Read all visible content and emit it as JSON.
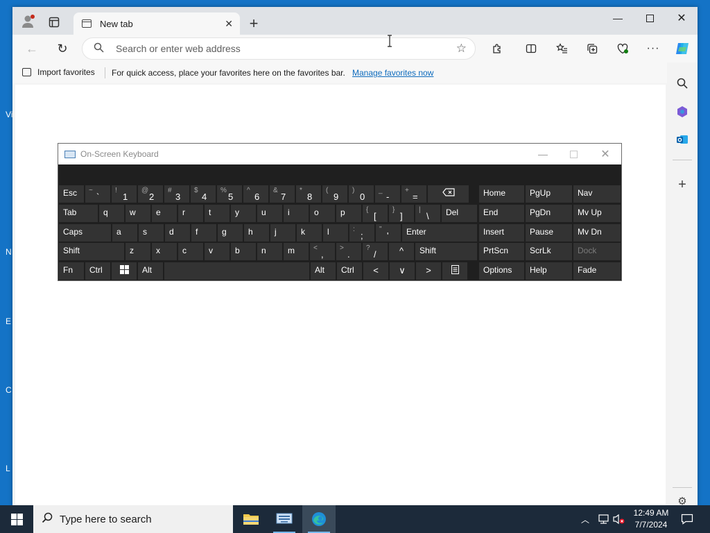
{
  "browser": {
    "tab_title": "New tab",
    "address_placeholder": "Search or enter web address",
    "favorites_bar": {
      "import_label": "Import favorites",
      "message": "For quick access, place your favorites here on the favorites bar.",
      "manage_link": "Manage favorites now"
    }
  },
  "desktop_edge_letters": [
    "Vi",
    "N",
    "E",
    "C",
    "L"
  ],
  "osk": {
    "title": "On-Screen Keyboard",
    "rows": [
      [
        {
          "t": "Esc"
        },
        {
          "s": "~",
          "m": "`"
        },
        {
          "s": "!",
          "m": "1"
        },
        {
          "s": "@",
          "m": "2"
        },
        {
          "s": "#",
          "m": "3"
        },
        {
          "s": "$",
          "m": "4"
        },
        {
          "s": "%",
          "m": "5"
        },
        {
          "s": "^",
          "m": "6"
        },
        {
          "s": "&",
          "m": "7"
        },
        {
          "s": "*",
          "m": "8"
        },
        {
          "s": "(",
          "m": "9"
        },
        {
          "s": ")",
          "m": "0"
        },
        {
          "s": "_",
          "m": "-"
        },
        {
          "s": "+",
          "m": "="
        },
        {
          "icon": "backspace"
        }
      ],
      [
        {
          "t": "Tab"
        },
        {
          "t": "q"
        },
        {
          "t": "w"
        },
        {
          "t": "e"
        },
        {
          "t": "r"
        },
        {
          "t": "t"
        },
        {
          "t": "y"
        },
        {
          "t": "u"
        },
        {
          "t": "i"
        },
        {
          "t": "o"
        },
        {
          "t": "p"
        },
        {
          "s": "{",
          "m": "["
        },
        {
          "s": "}",
          "m": "]"
        },
        {
          "s": "|",
          "m": "\\"
        },
        {
          "t": "Del"
        }
      ],
      [
        {
          "t": "Caps"
        },
        {
          "t": "a"
        },
        {
          "t": "s"
        },
        {
          "t": "d"
        },
        {
          "t": "f"
        },
        {
          "t": "g"
        },
        {
          "t": "h"
        },
        {
          "t": "j"
        },
        {
          "t": "k"
        },
        {
          "t": "l"
        },
        {
          "s": ":",
          "m": ";"
        },
        {
          "s": "\"",
          "m": "'"
        },
        {
          "t": "Enter"
        }
      ],
      [
        {
          "t": "Shift"
        },
        {
          "t": "z"
        },
        {
          "t": "x"
        },
        {
          "t": "c"
        },
        {
          "t": "v"
        },
        {
          "t": "b"
        },
        {
          "t": "n"
        },
        {
          "t": "m"
        },
        {
          "s": "<",
          "m": ","
        },
        {
          "s": ">",
          "m": "."
        },
        {
          "s": "?",
          "m": "/"
        },
        {
          "c": "^"
        },
        {
          "t": "Shift"
        }
      ],
      [
        {
          "t": "Fn"
        },
        {
          "t": "Ctrl"
        },
        {
          "icon": "windows"
        },
        {
          "t": "Alt"
        },
        {
          "t": ""
        },
        {
          "t": "Alt"
        },
        {
          "t": "Ctrl"
        },
        {
          "c": "<"
        },
        {
          "c": "∨"
        },
        {
          "c": ">"
        },
        {
          "icon": "menu"
        }
      ]
    ],
    "nav_rows": [
      [
        "Home",
        "PgUp",
        "Nav"
      ],
      [
        "End",
        "PgDn",
        "Mv Up"
      ],
      [
        "Insert",
        "Pause",
        "Mv Dn"
      ],
      [
        "PrtScn",
        "ScrLk",
        "Dock"
      ],
      [
        "Options",
        "Help",
        "Fade"
      ]
    ]
  },
  "taskbar": {
    "search_placeholder": "Type here to search",
    "time": "12:49 AM",
    "date": "7/7/2024"
  },
  "colors": {
    "desktop": "#1473c6",
    "taskbar": "#1c2a3a",
    "link": "#0f6cbd",
    "osk_key": "#333333"
  }
}
